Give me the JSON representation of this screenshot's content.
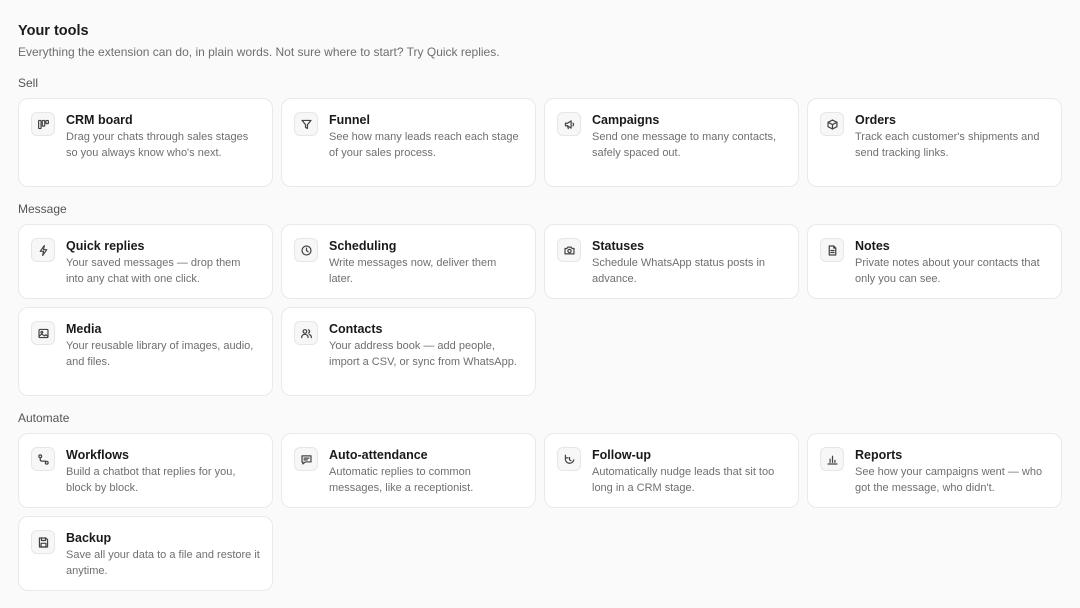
{
  "header": {
    "title": "Your tools",
    "subtitle": "Everything the extension can do, in plain words. Not sure where to start? Try Quick replies."
  },
  "sections": {
    "sell": {
      "label": "Sell",
      "cards": [
        {
          "title": "CRM board",
          "desc": "Drag your chats through sales stages so you always know who's next.",
          "icon": "kanban-icon"
        },
        {
          "title": "Funnel",
          "desc": "See how many leads reach each stage of your sales process.",
          "icon": "funnel-icon"
        },
        {
          "title": "Campaigns",
          "desc": "Send one message to many contacts, safely spaced out.",
          "icon": "megaphone-icon"
        },
        {
          "title": "Orders",
          "desc": "Track each customer's shipments and send tracking links.",
          "icon": "package-icon"
        }
      ]
    },
    "message": {
      "label": "Message",
      "cards": [
        {
          "title": "Quick replies",
          "desc": "Your saved messages — drop them into any chat with one click.",
          "icon": "lightning-icon"
        },
        {
          "title": "Scheduling",
          "desc": "Write messages now, deliver them later.",
          "icon": "clock-icon"
        },
        {
          "title": "Statuses",
          "desc": "Schedule WhatsApp status posts in advance.",
          "icon": "camera-icon"
        },
        {
          "title": "Notes",
          "desc": "Private notes about your contacts that only you can see.",
          "icon": "document-icon"
        },
        {
          "title": "Media",
          "desc": "Your reusable library of images, audio, and files.",
          "icon": "image-icon"
        },
        {
          "title": "Contacts",
          "desc": "Your address book — add people, import a CSV, or sync from WhatsApp.",
          "icon": "users-icon"
        }
      ]
    },
    "automate": {
      "label": "Automate",
      "cards": [
        {
          "title": "Workflows",
          "desc": "Build a chatbot that replies for you, block by block.",
          "icon": "workflow-icon"
        },
        {
          "title": "Auto-attendance",
          "desc": "Automatic replies to common messages, like a receptionist.",
          "icon": "chat-icon"
        },
        {
          "title": "Follow-up",
          "desc": "Automatically nudge leads that sit too long in a CRM stage.",
          "icon": "clock-rotate-icon"
        },
        {
          "title": "Reports",
          "desc": "See how your campaigns went — who got the message, who didn't.",
          "icon": "bar-chart-icon"
        },
        {
          "title": "Backup",
          "desc": "Save all your data to a file and restore it anytime.",
          "icon": "save-icon"
        }
      ]
    }
  }
}
